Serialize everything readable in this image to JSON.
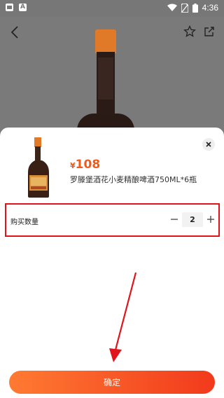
{
  "status_bar": {
    "time": "4:36"
  },
  "product": {
    "currency": "¥",
    "price": "108",
    "title": "罗滕堡酒花小麦精酿啤酒750ML*6瓶"
  },
  "quantity": {
    "label": "购买数量",
    "value": "2",
    "minus": "−",
    "plus": "+"
  },
  "confirm_label": "确定",
  "colors": {
    "accent": "#f25a1a",
    "annotation": "#e0141a"
  }
}
